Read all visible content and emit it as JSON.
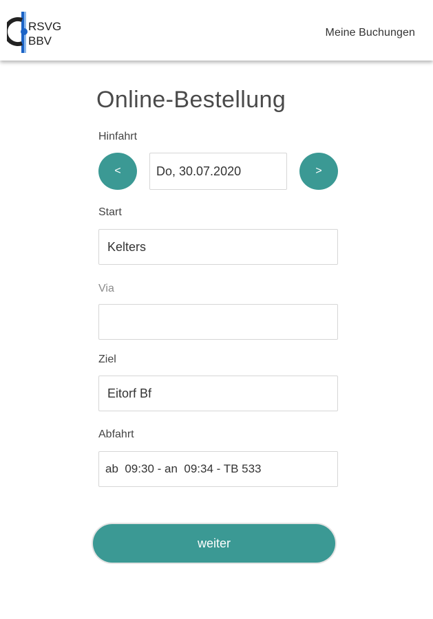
{
  "header": {
    "logo_top": "RSVG",
    "logo_bottom": "BBV",
    "nav_link": "Meine Buchungen"
  },
  "form": {
    "title": "Online-Bestellung",
    "hinfahrt": {
      "label": "Hinfahrt",
      "prev_label": "<",
      "date_value": "Do, 30.07.2020",
      "next_label": ">"
    },
    "start": {
      "label": "Start",
      "value": "Kelters"
    },
    "via": {
      "label": "Via",
      "value": ""
    },
    "ziel": {
      "label": "Ziel",
      "value": "Eitorf Bf"
    },
    "abfahrt": {
      "label": "Abfahrt",
      "value": "ab  09:30 - an  09:34 - TB 533"
    },
    "submit_label": "weiter"
  },
  "colors": {
    "accent": "#3b9994",
    "logo_blue": "#1b63c6",
    "text": "#333333",
    "border": "#d6d6d6"
  }
}
